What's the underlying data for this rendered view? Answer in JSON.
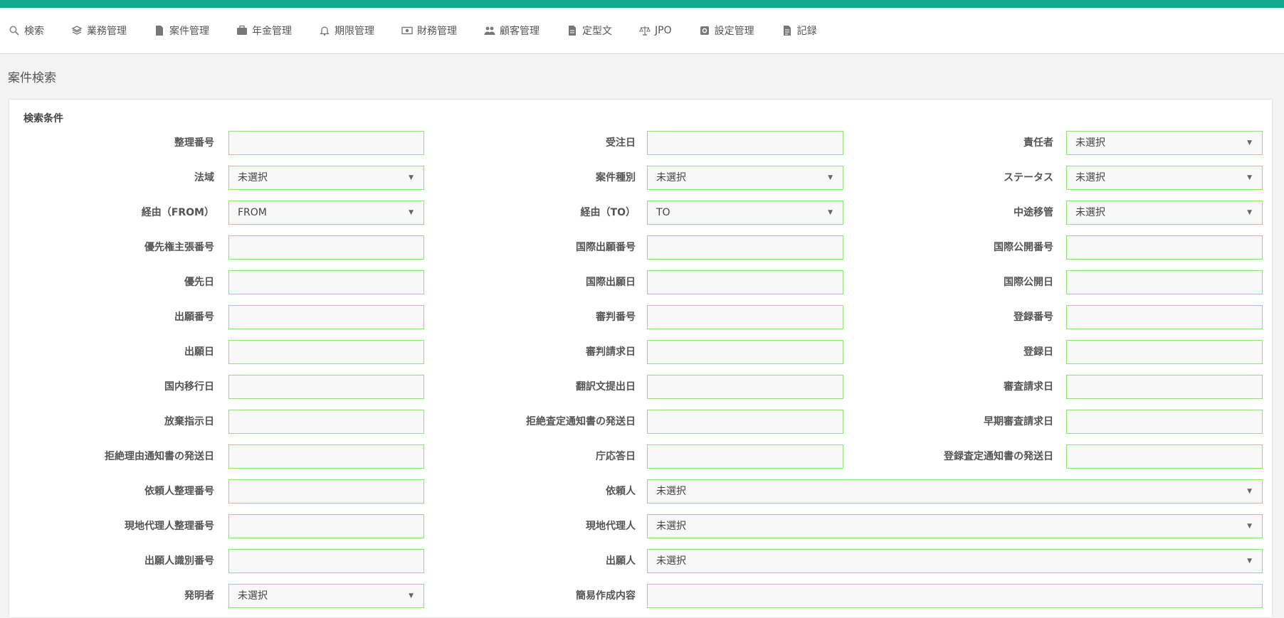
{
  "nav": [
    {
      "label": "検索",
      "icon": "search-icon"
    },
    {
      "label": "業務管理",
      "icon": "stack-icon"
    },
    {
      "label": "案件管理",
      "icon": "file-icon"
    },
    {
      "label": "年金管理",
      "icon": "briefcase-icon"
    },
    {
      "label": "期限管理",
      "icon": "bell-icon"
    },
    {
      "label": "財務管理",
      "icon": "money-icon"
    },
    {
      "label": "顧客管理",
      "icon": "users-icon"
    },
    {
      "label": "定型文",
      "icon": "document-icon"
    },
    {
      "label": "JPO",
      "icon": "scale-icon"
    },
    {
      "label": "設定管理",
      "icon": "gear-box-icon"
    },
    {
      "label": "記録",
      "icon": "record-icon"
    }
  ],
  "page_title": "案件検索",
  "panel_title": "検索条件",
  "placeholder_select": "未選択",
  "rows": [
    {
      "c1": {
        "label": "整理番号",
        "type": "text",
        "value": ""
      },
      "c2": {
        "label": "受注日",
        "type": "text",
        "value": ""
      },
      "c3": {
        "label": "責任者",
        "type": "select",
        "value": "未選択"
      }
    },
    {
      "c1": {
        "label": "法域",
        "type": "select",
        "value": "未選択"
      },
      "c2": {
        "label": "案件種別",
        "type": "select",
        "value": "未選択"
      },
      "c3": {
        "label": "ステータス",
        "type": "select",
        "value": "未選択"
      }
    },
    {
      "c1": {
        "label": "経由（FROM）",
        "type": "select",
        "value": "FROM"
      },
      "c2": {
        "label": "経由（TO）",
        "type": "select",
        "value": "TO"
      },
      "c3": {
        "label": "中途移管",
        "type": "select",
        "value": "未選択"
      }
    },
    {
      "c1": {
        "label": "優先権主張番号",
        "type": "text",
        "value": ""
      },
      "c2": {
        "label": "国際出願番号",
        "type": "text",
        "value": ""
      },
      "c3": {
        "label": "国際公開番号",
        "type": "text",
        "value": ""
      }
    },
    {
      "c1": {
        "label": "優先日",
        "type": "text",
        "value": ""
      },
      "c2": {
        "label": "国際出願日",
        "type": "text",
        "value": ""
      },
      "c3": {
        "label": "国際公開日",
        "type": "text",
        "value": ""
      }
    },
    {
      "c1": {
        "label": "出願番号",
        "type": "text",
        "value": ""
      },
      "c2": {
        "label": "審判番号",
        "type": "text",
        "value": ""
      },
      "c3": {
        "label": "登録番号",
        "type": "text",
        "value": ""
      }
    },
    {
      "c1": {
        "label": "出願日",
        "type": "text",
        "value": ""
      },
      "c2": {
        "label": "審判請求日",
        "type": "text",
        "value": ""
      },
      "c3": {
        "label": "登録日",
        "type": "text",
        "value": ""
      }
    },
    {
      "c1": {
        "label": "国内移行日",
        "type": "text",
        "value": ""
      },
      "c2": {
        "label": "翻訳文提出日",
        "type": "text",
        "value": ""
      },
      "c3": {
        "label": "審査請求日",
        "type": "text",
        "value": ""
      }
    },
    {
      "c1": {
        "label": "放棄指示日",
        "type": "text",
        "value": ""
      },
      "c2": {
        "label": "拒絶査定通知書の発送日",
        "type": "text",
        "value": ""
      },
      "c3": {
        "label": "早期審査請求日",
        "type": "text",
        "value": ""
      }
    },
    {
      "c1": {
        "label": "拒絶理由通知書の発送日",
        "type": "text",
        "value": ""
      },
      "c2": {
        "label": "庁応答日",
        "type": "text",
        "value": ""
      },
      "c3": {
        "label": "登録査定通知書の発送日",
        "type": "text",
        "value": ""
      }
    },
    {
      "c1": {
        "label": "依頼人整理番号",
        "type": "text",
        "value": ""
      },
      "c2": {
        "label": "依頼人",
        "type": "select-wide",
        "value": "未選択"
      }
    },
    {
      "c1": {
        "label": "現地代理人整理番号",
        "type": "text",
        "value": ""
      },
      "c2": {
        "label": "現地代理人",
        "type": "select-wide",
        "value": "未選択"
      }
    },
    {
      "c1": {
        "label": "出願人識別番号",
        "type": "text",
        "value": ""
      },
      "c2": {
        "label": "出願人",
        "type": "select-wide",
        "value": "未選択"
      }
    },
    {
      "c1": {
        "label": "発明者",
        "type": "select",
        "value": "未選択"
      },
      "c2": {
        "label": "簡易作成内容",
        "type": "text-wide",
        "value": ""
      }
    }
  ],
  "colors": {
    "accent": "#12a88f",
    "field_border": "#8fe17a"
  }
}
